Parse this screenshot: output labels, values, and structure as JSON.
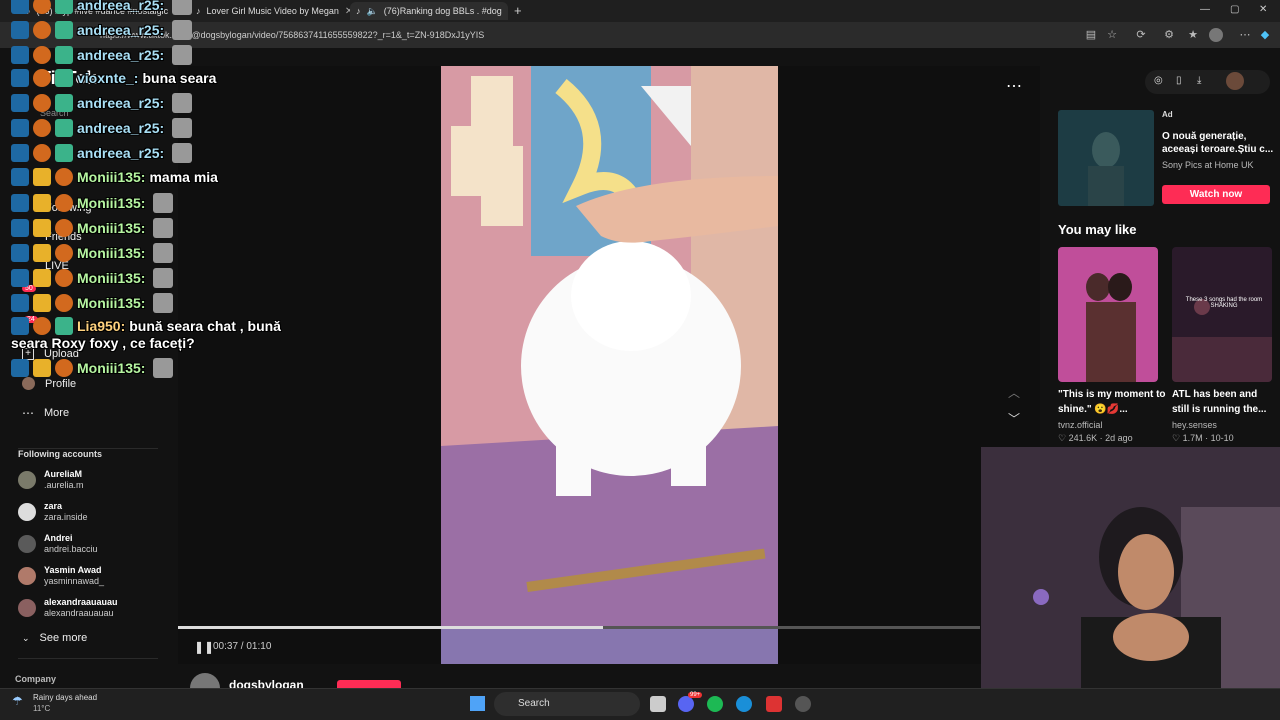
{
  "browser": {
    "tabs": [
      {
        "label": "(76) #fyp #live #dance #nostalgic",
        "active": false
      },
      {
        "label": "Lover Girl Music Video by Megan",
        "active": false
      },
      {
        "label": "(76)Ranking dog BBLs . #dog",
        "active": true
      }
    ],
    "url": "https://www.tiktok.com/@dogsbylogan/video/7568637411655559822?_r=1&_t=ZN-918DxJ1yYIS",
    "new_tab": "+"
  },
  "sidebar": {
    "logo": "TikTok",
    "search_placeholder": "Search",
    "items": [
      {
        "label": "Following",
        "icon": "users-icon"
      },
      {
        "label": "Friends",
        "icon": "friends-icon"
      },
      {
        "label": "LIVE",
        "icon": "live-icon"
      },
      {
        "label": "Upload",
        "icon": "upload-icon"
      },
      {
        "label": "Profile",
        "icon": "profile-icon"
      },
      {
        "label": "More",
        "icon": "more-icon"
      }
    ],
    "following_title": "Following accounts",
    "accounts": [
      {
        "name": "AureliaM",
        "handle": ".aurelia.m"
      },
      {
        "name": "zara",
        "handle": "zara.inside"
      },
      {
        "name": "Andrei",
        "handle": "andrei.bacciu"
      },
      {
        "name": "Yasmin Awad",
        "handle": "yasminnawad_"
      },
      {
        "name": "alexandraauauau",
        "handle": "alexandraauauau"
      }
    ],
    "see_more": "See more",
    "company": "Company",
    "badge_live": "50",
    "badge_msg": "24"
  },
  "player": {
    "time": "00:37 / 01:10",
    "progress": 0.53,
    "author": "dogsbylogan"
  },
  "right": {
    "ad_label": "Ad",
    "ad_title": "O nouă generație, aceeași teroare.Știu c...",
    "ad_sponsor": "Sony Pics at Home UK",
    "ad_button": "Watch now",
    "you_may_like": "You may like",
    "cards": [
      {
        "caption": "\"This is my moment to shine.\" 😮💋...",
        "author": "tvnz.official",
        "views": "241.6K",
        "age": "2d ago"
      },
      {
        "caption": "ATL has been and still is running the...",
        "author": "hey.senses",
        "views": "1.7M",
        "age": "10-10",
        "overlay": "These 3 songs had the room SHAKING"
      }
    ]
  },
  "chat": [
    {
      "user": "andreea_r25:",
      "msg": "",
      "color": "u1"
    },
    {
      "user": "andreea_r25:",
      "msg": "",
      "color": "u1"
    },
    {
      "user": "andreea_r25:",
      "msg": "",
      "color": "u1"
    },
    {
      "user": "vioxnte_:",
      "msg": "buna seara",
      "color": "u1"
    },
    {
      "user": "andreea_r25:",
      "msg": "",
      "color": "u1"
    },
    {
      "user": "andreea_r25:",
      "msg": "",
      "color": "u1"
    },
    {
      "user": "andreea_r25:",
      "msg": "",
      "color": "u1"
    },
    {
      "user": "Moniii135:",
      "msg": "mama mia",
      "color": "u2"
    },
    {
      "user": "Moniii135:",
      "msg": "",
      "color": "u2"
    },
    {
      "user": "Moniii135:",
      "msg": "",
      "color": "u2"
    },
    {
      "user": "Moniii135:",
      "msg": "",
      "color": "u2"
    },
    {
      "user": "Moniii135:",
      "msg": "",
      "color": "u2"
    },
    {
      "user": "Moniii135:",
      "msg": "",
      "color": "u2"
    },
    {
      "user": "Lia950:",
      "msg": "bună seara chat , bună",
      "color": "u3"
    },
    {
      "user": "",
      "msg": "seara Roxy foxy , ce faceți?",
      "color": "u3"
    },
    {
      "user": "Moniii135:",
      "msg": "",
      "color": "u2"
    }
  ],
  "taskbar": {
    "weather_title": "Rainy days ahead",
    "weather_temp": "11°C",
    "search": "Search",
    "notif": "99+"
  },
  "colors": {
    "accent": "#fe2c55",
    "bg": "#121212"
  }
}
